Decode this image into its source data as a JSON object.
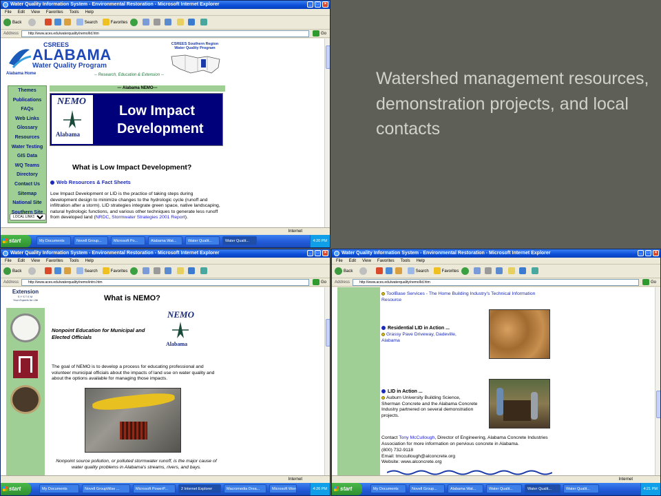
{
  "slide": {
    "caption": "Watershed management resources, demonstration projects, and local contacts"
  },
  "colors": {
    "title_bar": "#0a4dd8",
    "taskbar": "#245edb",
    "sidenav_green": "#9fcf95",
    "nemo_blue": "#00007a"
  },
  "browser": {
    "title": "Water Quality Information System - Environmental Restoration - Microsoft Internet Explorer",
    "menus": [
      "File",
      "Edit",
      "View",
      "Favorites",
      "Tools",
      "Help"
    ],
    "toolbar": {
      "back": "Back",
      "search": "Search",
      "favorites": "Favorites"
    },
    "address_label": "Address",
    "go_label": "Go",
    "status_zone": "Internet",
    "start_label": "start"
  },
  "win1": {
    "url": "http://www.aces.edu/waterquality/nemo/lid.htm",
    "header": {
      "csrees": "CSREES",
      "alabama": "ALABAMA",
      "program": "Water Quality Program",
      "home": "Alabama Home",
      "tagline": "-- Research, Education & Extension --",
      "region_line1": "CSREES Southern Region",
      "region_line2": "Water Quality Program"
    },
    "nav_items": [
      "Themes",
      "Publications",
      "FAQs",
      "Web Links",
      "Glossary",
      "Resources",
      "Water Testing",
      "GIS Data",
      "WQ Teams",
      "Directory",
      "Contact Us",
      "Sitemap",
      "National Site",
      "Southern Site"
    ],
    "local_links": "LOCAL LINKS",
    "nemo_bar": "--- Alabama NEMO---",
    "banner_line1": "Low Impact",
    "banner_line2": "Development",
    "logo_nemo": "NEMO",
    "logo_state": "Alabama",
    "heading": "What is Low Impact Development?",
    "resources_link": "Web Resources & Fact Sheets",
    "body_text": "Low Impact Development or LID is the practice of taking steps during development design to minimize changes to the hydrologic cycle (runoff and infiltration after a storm). LID strategies integrate green space, native landscaping, natural hydrologic functions, and various other techniques to generate less runoff from developed land (",
    "body_link1": "NRDC",
    "body_sep": ", ",
    "body_link2": "Stormwater Strategies 2001 Report",
    "body_end": ").",
    "tasks": [
      "My Documents",
      "Novell Group...",
      "Microsoft Po...",
      "Alabama Wat...",
      "Water Qualit...",
      "Water Qualit..."
    ],
    "clock": "4:20 PM"
  },
  "win2": {
    "url": "http://www.aces.edu/waterquality/nemo/intro.htm",
    "extension_line1": "Extension",
    "extension_line2": "SYSTEM",
    "extension_tag": "Your Experts for Life",
    "heading": "What is NEMO?",
    "subheading": "Nonpoint Education for Municipal and Elected Officials",
    "logo_nemo": "NEMO",
    "logo_state": "Alabama",
    "paragraph": "The goal of NEMO is to develop a process for educating professional and volunteer municipal officials about the impacts of land use on water quality and about the options available for managing those impacts.",
    "caption": "Nonpoint source pollution, or polluted stormwater runoff, is the major cause of water quality problems in Alabama's streams, rivers, and bays.",
    "tasks": [
      "My Documents",
      "Novell GroupWise ...",
      "Microsoft PowerP...",
      "2 Internet Explorer",
      "Macromedia Drea...",
      "Microsoft Word ..."
    ],
    "clock": "4:26 PM"
  },
  "win3": {
    "url": "http://www.aces.edu/waterquality/nemo/lid.htm",
    "toolbase_link": "ToolBase Services - The Home Building Industry's Technical Information Resource",
    "residential_heading": "Residential LID in Action ...",
    "grassy_link": "Grassy Pave Driveway, Dadeville, Alabama",
    "lid_heading": "LID in Action ...",
    "lid_text": "Auburn University Building Science, Sherman Concrete and the Alabama Concrete Industry partnered on several demonstration projects.",
    "contact_prefix": "Contact ",
    "contact_name": "Tony McCullough",
    "contact_text": ", Director of Engineering, Alabama Concrete Industries Association for more information on pervious concrete in Alabama.",
    "phone": "(800) 732-9118",
    "email": "Email: tmccullough@alconcrete.org",
    "website": "Website: www.alconcrete.org",
    "tasks": [
      "My Documents",
      "Novell Group...",
      "Alabama Wat...",
      "Water Qualit...",
      "Water Qualit...",
      "Water Qualit..."
    ],
    "clock": "4:21 PM"
  }
}
